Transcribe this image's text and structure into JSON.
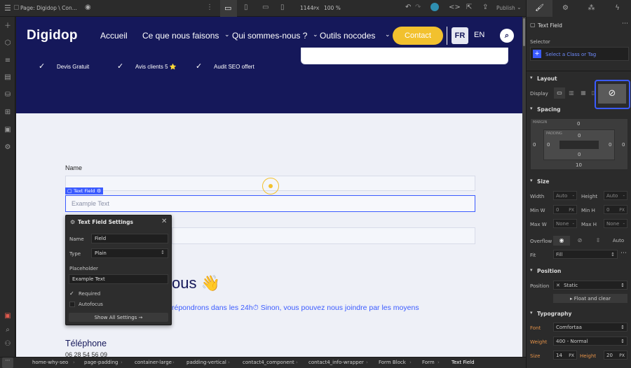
{
  "topbar": {
    "page_label": "Page: Digidop \\ Con...",
    "width_value": "1144",
    "width_unit": "PX",
    "zoom": "100 %",
    "publish_label": "Publish"
  },
  "site": {
    "logo": "Digidop",
    "nav": [
      "Accueil",
      "Ce que nous faisons",
      "Qui sommes-nous ?",
      "Outils nocodes"
    ],
    "contact_button": "Contact",
    "lang_fr": "FR",
    "lang_en": "EN",
    "checks": [
      "Devis Gratuit",
      "Avis clients 5 ⭐",
      "Audit SEO offert"
    ],
    "name_label": "Name",
    "selected_tag": "Text Field",
    "placeholder_example": "Example Text",
    "heading_partial": "ous 👋",
    "paragraph_partial": "répondrons dans les 24h⏱ Sinon, vous pouvez nous joindre par les moyens",
    "telephone_label": "Téléphone",
    "telephone_value": "06 28 54 56 09"
  },
  "popup": {
    "title": "Text Field Settings",
    "name_label": "Name",
    "name_value": "Field",
    "type_label": "Type",
    "type_value": "Plain",
    "placeholder_label": "Placeholder",
    "placeholder_value": "Example Text",
    "required_label": "Required",
    "autofocus_label": "Autofocus",
    "show_all_label": "Show All Settings →"
  },
  "panel": {
    "element_title": "Text Field",
    "selector_label": "Selector",
    "selector_placeholder": "Select a Class or Tag",
    "layout_label": "Layout",
    "display_label": "Display",
    "spacing_label": "Spacing",
    "margin_label": "MARGIN",
    "padding_label": "PADDING",
    "margin_top": "0",
    "margin_left": "0",
    "margin_right": "0",
    "margin_bottom": "10",
    "padding_top": "0",
    "padding_left": "0",
    "padding_right": "0",
    "padding_bottom": "0",
    "size_label": "Size",
    "width_label": "Width",
    "width_value": "Auto",
    "height_label": "Height",
    "height_value": "Auto",
    "minw_label": "Min W",
    "minw_value": "0",
    "minh_label": "Min H",
    "minh_value": "0",
    "maxw_label": "Max W",
    "maxw_value": "None",
    "maxh_label": "Max H",
    "maxh_value": "None",
    "unit_px": "PX",
    "unit_dash": "-",
    "overflow_label": "Overflow",
    "overflow_auto": "Auto",
    "fit_label": "Fit",
    "fit_value": "Fill",
    "position_header": "Position",
    "position_label": "Position",
    "position_value": "Static",
    "float_label": "Float and clear",
    "typography_label": "Typography",
    "font_label": "Font",
    "font_value": "Comfortaa",
    "weight_label": "Weight",
    "weight_value": "400 - Normal",
    "size_font_label": "Size",
    "size_font_value": "14",
    "height_font_label": "Height",
    "height_font_value": "20"
  },
  "breadcrumbs": [
    "home-why-seo",
    "page-padding",
    "container-large",
    "padding-vertical",
    "contact4_component",
    "contact4_info-wrapper",
    "Form Block",
    "Form",
    "Text Field"
  ],
  "colors": {
    "hero_bg": "#15185a",
    "brand_yellow": "#f2c12e",
    "highlight_blue": "#3b5bff",
    "editor_orange": "#e39148"
  }
}
